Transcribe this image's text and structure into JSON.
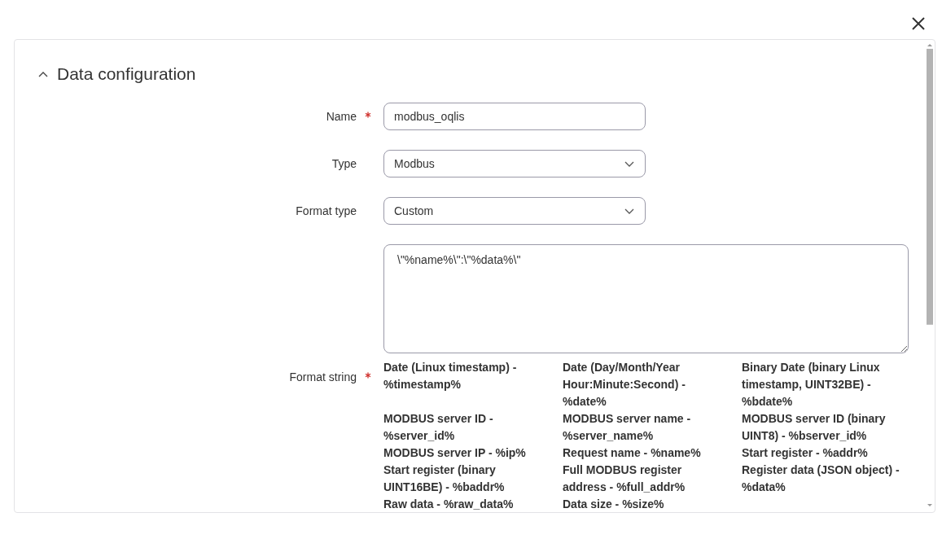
{
  "section": {
    "title": "Data configuration",
    "expanded": true
  },
  "fields": [
    {
      "kind": "text",
      "label": "Name",
      "required": true,
      "value": "modbus_oqlis"
    },
    {
      "kind": "select",
      "label": "Type",
      "required": false,
      "value": "Modbus"
    },
    {
      "kind": "select",
      "label": "Format type",
      "required": false,
      "value": "Custom"
    }
  ],
  "format_string": {
    "label": "Format string",
    "required": true,
    "value": "\\\"%name%\\\":\\\"%data%\\\"",
    "hints": [
      "Date (Linux timestamp) - %timestamp%",
      "Date (Day/Month/Year Hour:Minute:Second) - %date%",
      "Binary Date (binary Linux timestamp, UINT32BE) - %bdate%",
      "MODBUS server ID - %server_id%",
      "MODBUS server name - %server_name%",
      "MODBUS server ID (binary UINT8) - %bserver_id%",
      "MODBUS server IP - %ip%",
      "Request name - %name%",
      "Start register - %addr%",
      "Start register (binary UINT16BE) - %baddr%",
      "Full MODBUS register address - %full_addr%",
      "Register data (JSON object) - %data%",
      "Raw data - %raw_data%",
      "Data size - %size%"
    ]
  }
}
